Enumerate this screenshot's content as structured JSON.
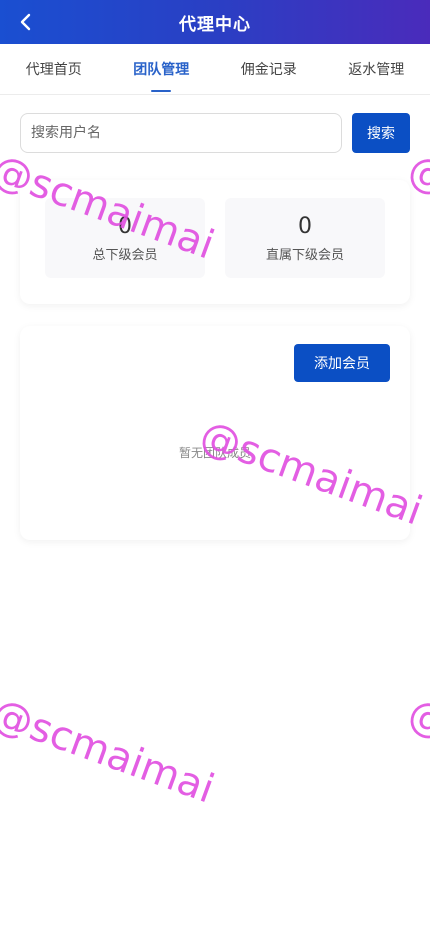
{
  "header": {
    "title": "代理中心",
    "back_icon": "chevron-left-icon"
  },
  "tabs": [
    {
      "label": "代理首页",
      "active": false
    },
    {
      "label": "团队管理",
      "active": true
    },
    {
      "label": "佣金记录",
      "active": false
    },
    {
      "label": "返水管理",
      "active": false
    }
  ],
  "search": {
    "placeholder": "搜索用户名",
    "value": "",
    "button_label": "搜索"
  },
  "stats": {
    "total_members_value": "0",
    "total_members_label": "总下级会员",
    "direct_members_value": "0",
    "direct_members_label": "直属下级会员"
  },
  "members": {
    "add_button_label": "添加会员",
    "empty_text": "暂无团队成员"
  },
  "watermark": {
    "text": "@scmaimai",
    "color": "#e04de0"
  },
  "colors": {
    "primary": "#0b4fc4",
    "header_start": "#1a4fd1",
    "header_end": "#4a2bbb",
    "active_tab": "#2962c9"
  }
}
